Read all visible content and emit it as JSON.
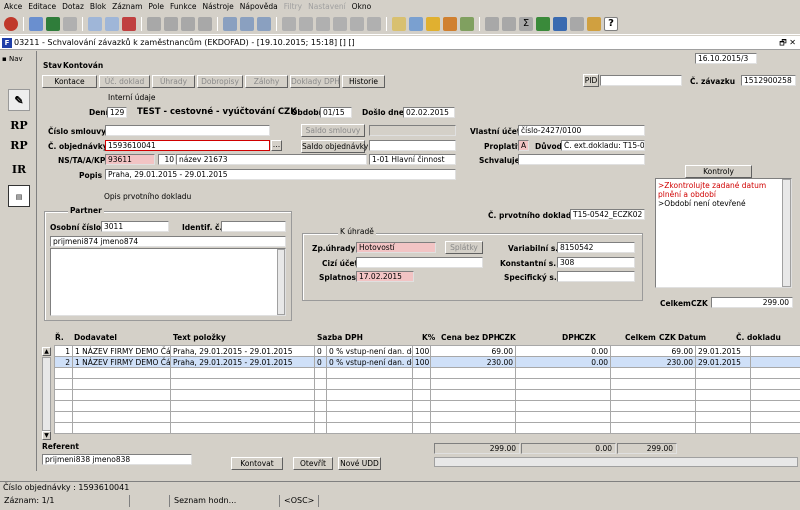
{
  "menu": [
    "Akce",
    "Editace",
    "Dotaz",
    "Blok",
    "Záznam",
    "Pole",
    "Funkce",
    "Nástroje",
    "Nápověda",
    "Filtry",
    "Nastavení",
    "Okno"
  ],
  "menu_disabled": [
    "Filtry",
    "Nastavení"
  ],
  "window": {
    "title": "03211 - Schvalování závazků k zaměstnancům (EKDOFAD) - [19.10.2015; 15:18] [] []",
    "controls": "🗗 ✕"
  },
  "left": {
    "nav_label": "Nav",
    "icons": [
      "RP",
      "RP",
      "IR"
    ]
  },
  "header": {
    "date": "16.10.2015/3",
    "stav_label": "Stav",
    "stav_value": "Kontován",
    "tabs": [
      "Kontace",
      "Úč. doklad",
      "Úhrady",
      "Dobropisy",
      "Zálohy",
      "Doklady DPH",
      "Historie"
    ],
    "pid_label": "PID",
    "pid_value": "",
    "cislo_zavazku_label": "Č. závazku",
    "cislo_zavazku": "1512900258"
  },
  "interni": {
    "section": "Interní údaje",
    "denik_label": "Deník",
    "denik": "129",
    "denik_text": "TEST - cestovné - vyúčtování CZK",
    "obdobi_label": "Období",
    "obdobi": "01/15",
    "doslo_label": "Došlo dne",
    "doslo": "02.02.2015",
    "cislo_smlouvy_label": "Číslo smlouvy",
    "cislo_smlouvy": "",
    "saldo_smlouvy_btn": "Saldo smlouvy",
    "c_objednavky_label": "Č. objednávky",
    "c_objednavky": "1593610041",
    "saldo_objednavky_btn": "Saldo objednávky",
    "ns_label": "NS/TA/A/KP",
    "ns": "93611",
    "ta": "10",
    "ta_name": "název 21673",
    "cinnost": "1-01 Hlavní činnost",
    "popis_label": "Popis",
    "popis": "Praha, 29.01.2015 - 29.01.2015",
    "vlastni_ucet_label": "Vlastní účet",
    "vlastni_ucet": "číslo-2427/0100",
    "proplatit_label": "Proplatit",
    "proplatit": "A",
    "duvod_label": "Důvod",
    "duvod": "Č. ext.dokladu: T15-0542",
    "schvaluje_label": "Schvaluje",
    "schvaluje": ""
  },
  "kontroly": {
    "button": "Kontroly",
    "messages": [
      ">Zkontrolujte zadané datum plnění a období",
      ">Období není otevřené"
    ]
  },
  "opis": {
    "section": "Opis prvotního dokladu",
    "prvotni_label": "Č. prvotního dokladu",
    "prvotni": "T15-0542_ECZK02"
  },
  "partner": {
    "section": "Partner",
    "osobni_label": "Osobní číslo",
    "osobni": "3011",
    "identif_label": "Identif. č.",
    "identif": "",
    "name": "prijmeni874 jmeno874"
  },
  "uhrade": {
    "section": "K úhradě",
    "zp_label": "Zp.úhrady",
    "zp": "Hotovostí",
    "splatky_btn": "Splátky",
    "cizi_label": "Cizí účet",
    "cizi": "",
    "splatnost_label": "Splatnost",
    "splatnost": "17.02.2015",
    "var_label": "Variabilní s.",
    "var": "8150542",
    "konst_label": "Konstantní s.",
    "konst": "308",
    "spec_label": "Specifický s.",
    "spec": ""
  },
  "celkem": {
    "label": "Celkem",
    "currency": "CZK",
    "value": "299.00"
  },
  "table": {
    "headers": {
      "r": "Ř.",
      "dod": "Dodavatel",
      "text": "Text položky",
      "sazba": "Sazba DPH",
      "k": "K%",
      "bez": "Cena bez DPH",
      "bez_c": "CZK",
      "dph": "DPH",
      "dph_c": "CZK",
      "cel": "Celkem",
      "cel_c": "CZK",
      "datum": "Datum",
      "cdok": "Č. dokladu"
    },
    "rows": [
      {
        "r": "1",
        "dod": "1 NÁZEV FIRMY DEMO Část",
        "text": "Praha, 29.01.2015 - 29.01.2015",
        "s1": "0",
        "s2": "0 % vstup-není dan. dokl",
        "k": "100",
        "bez": "69.00",
        "dph": "0.00",
        "cel": "69.00",
        "datum": "29.01.2015",
        "cdok": ""
      },
      {
        "r": "2",
        "dod": "1 NÁZEV FIRMY DEMO Část",
        "text": "Praha, 29.01.2015 - 29.01.2015",
        "s1": "0",
        "s2": "0 % vstup-není dan. dokl",
        "k": "100",
        "bez": "230.00",
        "dph": "0.00",
        "cel": "230.00",
        "datum": "29.01.2015",
        "cdok": ""
      }
    ],
    "totals": {
      "bez": "299.00",
      "dph": "0.00",
      "cel": "299.00"
    }
  },
  "referent": {
    "label": "Referent",
    "value": "prijmeni838 jmeno838"
  },
  "buttons": {
    "kontovat": "Kontovat",
    "otevrit": "Otevřít",
    "nove": "Nové UDD"
  },
  "status": {
    "line1": "Číslo objednávky : 1593610041",
    "zaznam": "Záznam: 1/1",
    "seznam": "Seznam hodn...",
    "osc": "<OSC>"
  }
}
